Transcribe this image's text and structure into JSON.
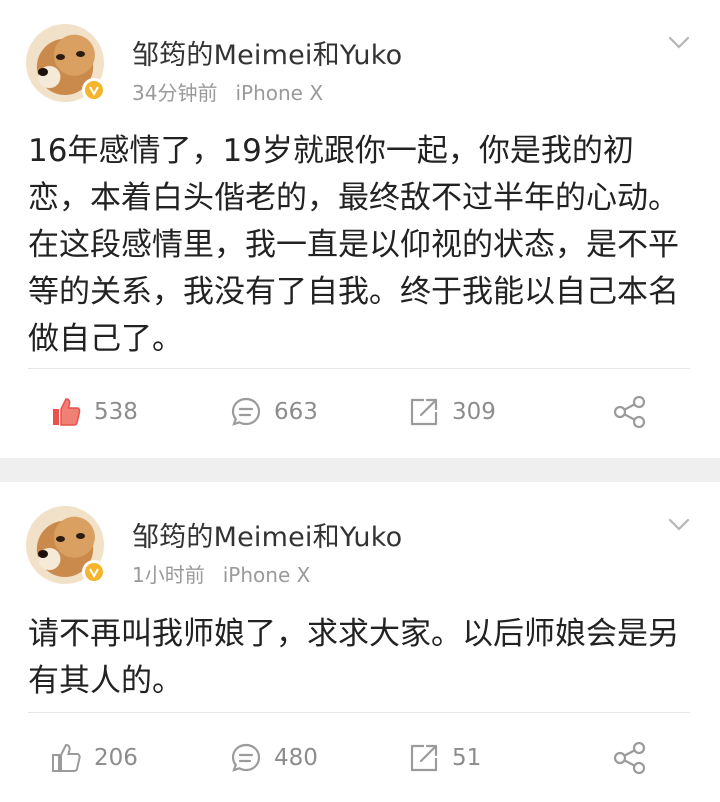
{
  "posts": [
    {
      "username": "邹筠的Meimei和Yuko",
      "time": "34分钟前",
      "device": "iPhone X",
      "content": "16年感情了，19岁就跟你一起，你是我的初恋，本着白头偕老的，最终敌不过半年的心动。在这段感情里，我一直是以仰视的状态，是不平等的关系，我没有了自我。终于我能以自己本名做自己了。",
      "likes": "538",
      "comments": "663",
      "reposts": "309",
      "liked": true
    },
    {
      "username": "邹筠的Meimei和Yuko",
      "time": "1小时前",
      "device": "iPhone X",
      "content": "请不再叫我师娘了，求求大家。以后师娘会是另有其人的。",
      "likes": "206",
      "comments": "480",
      "reposts": "51",
      "liked": false
    }
  ],
  "colors": {
    "liked": "#e8524a",
    "icon": "#9b9b9b",
    "verified": "#f4b52c",
    "separator": "#efefef"
  },
  "icons": [
    "chevron-down-icon",
    "thumbs-up-icon",
    "comment-icon",
    "repost-icon",
    "share-icon",
    "verified-badge-icon"
  ]
}
